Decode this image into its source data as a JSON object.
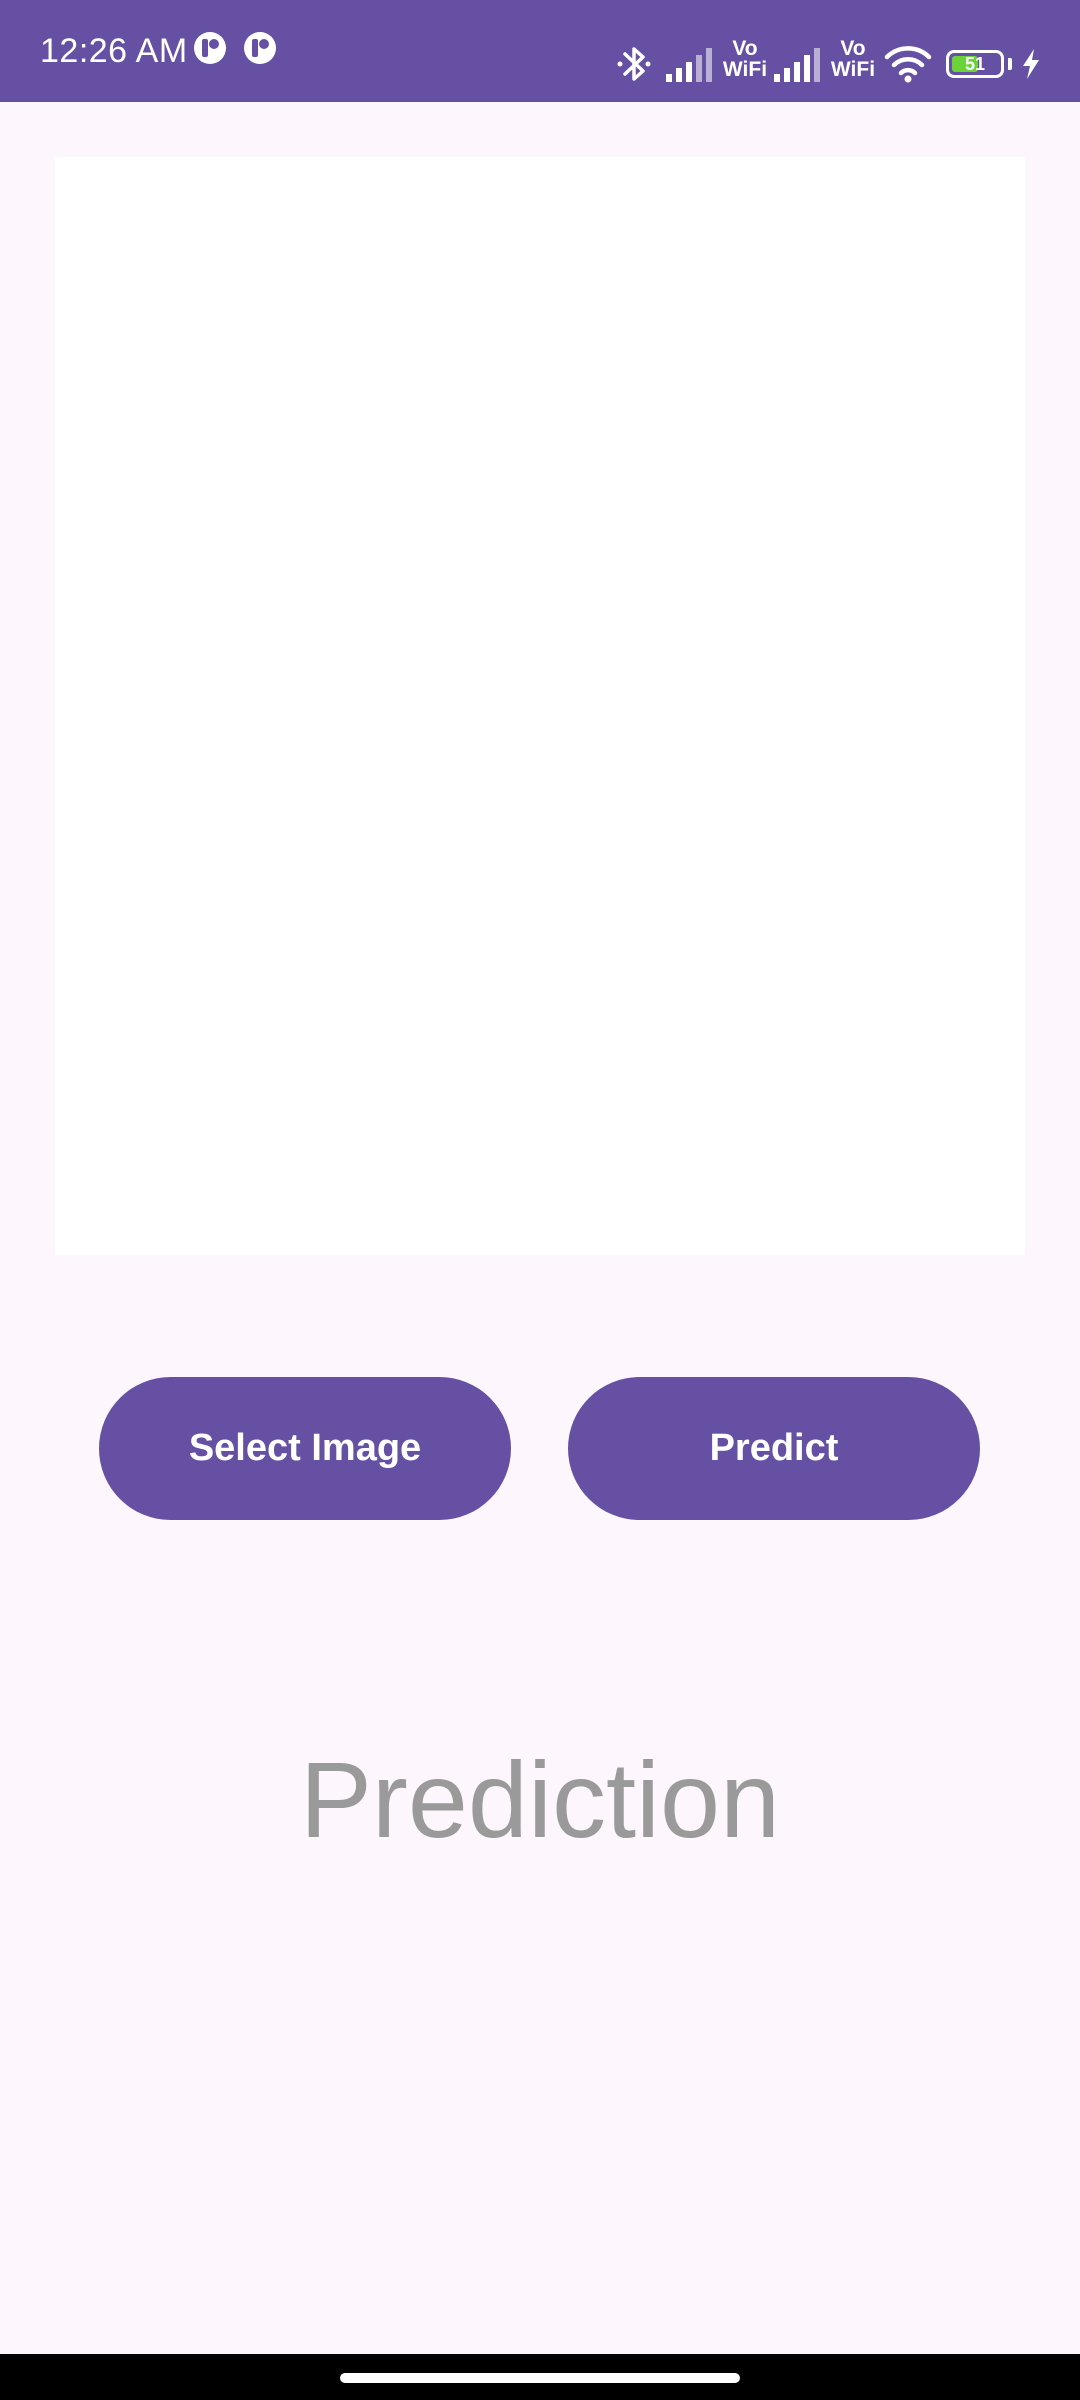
{
  "status_bar": {
    "time": "12:26 AM",
    "vowifi_1": "Vo\nWiFi",
    "vowifi_2": "Vo\nWiFi",
    "battery_level": "51",
    "colors": {
      "background": "#6650A4",
      "battery_fill": "#6BD33A"
    },
    "icons": [
      "notification-app-icon",
      "notification-app-icon",
      "bluetooth-icon",
      "signal-icon",
      "signal-icon",
      "wifi-icon",
      "battery-icon",
      "charging-icon"
    ]
  },
  "main": {
    "select_button_label": "Select Image",
    "predict_button_label": "Predict",
    "prediction_text": "Prediction",
    "colors": {
      "background": "#FDF6FC",
      "button": "#6650A4",
      "prediction_text": "#9A9A9A"
    }
  }
}
